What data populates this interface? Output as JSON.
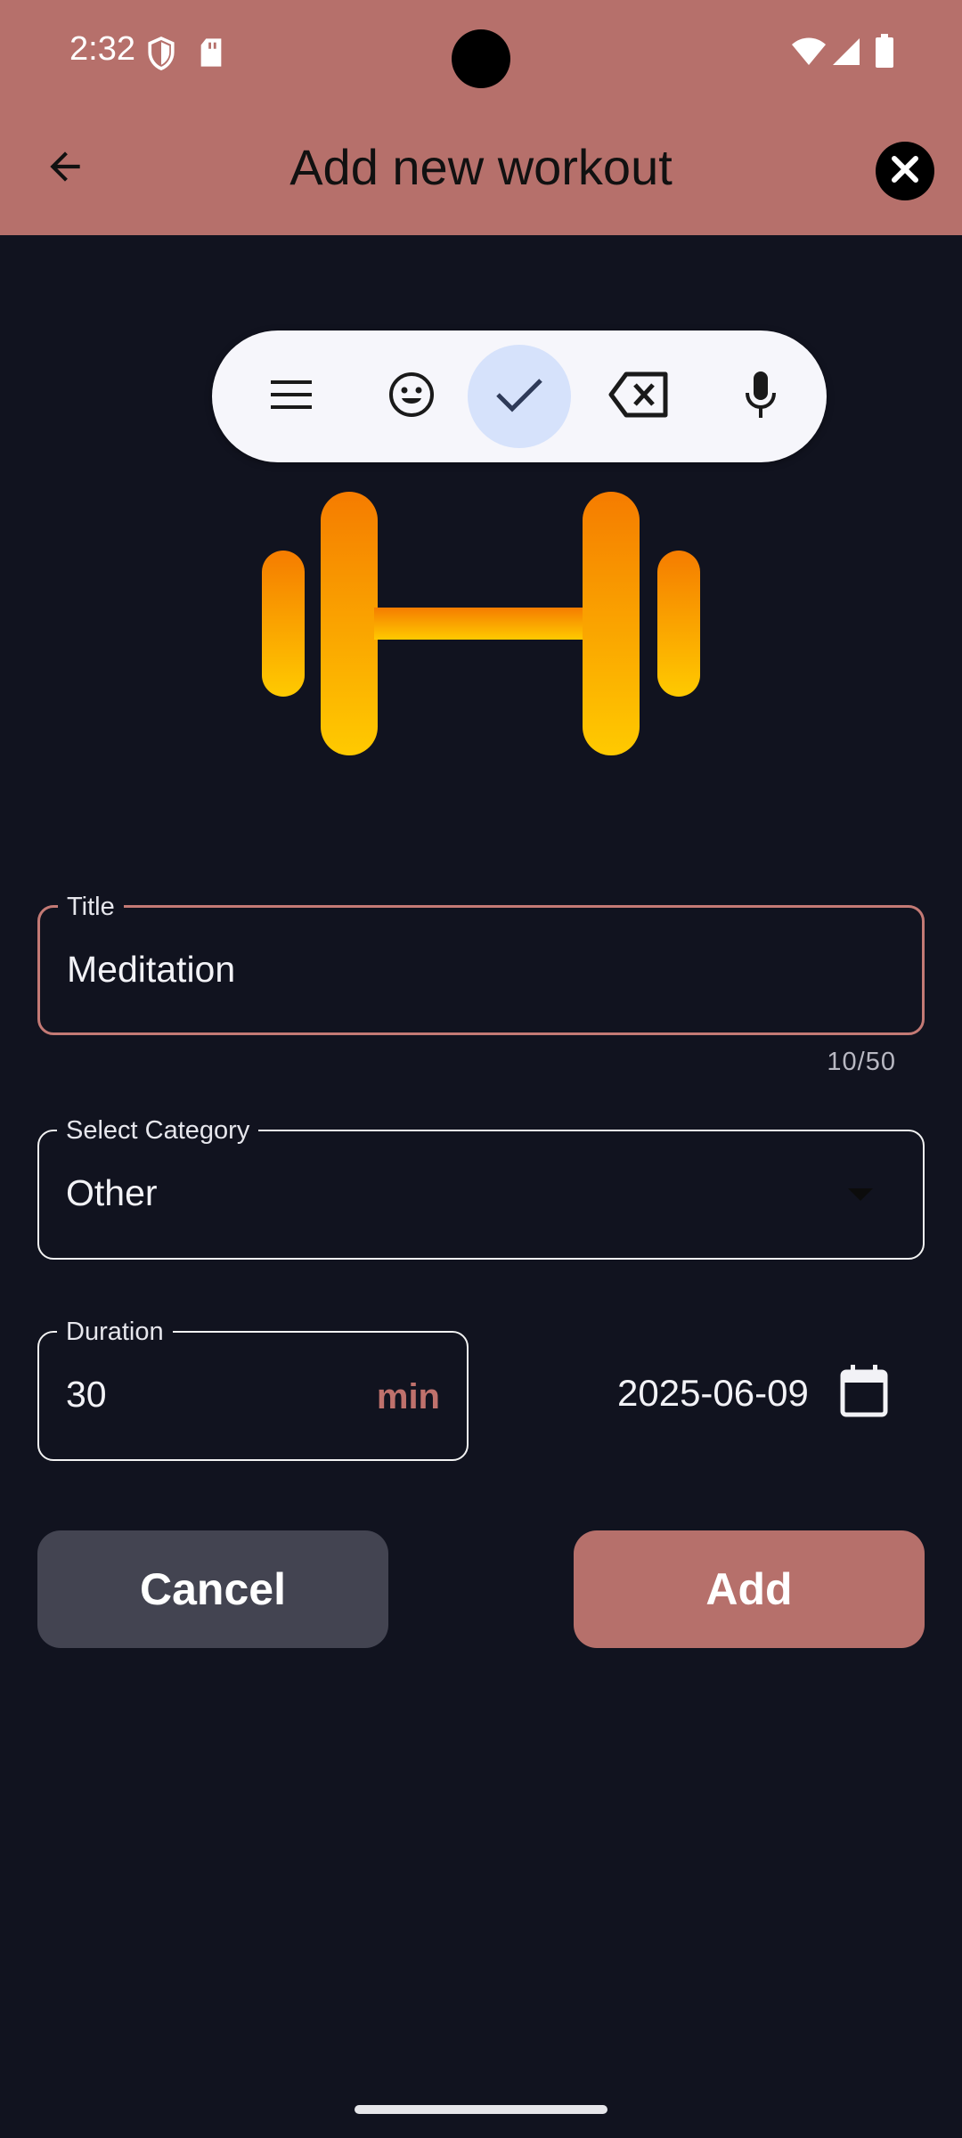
{
  "status_bar": {
    "time": "2:32",
    "icons": [
      "shield-icon",
      "sd-card-icon",
      "wifi-icon",
      "cell-signal-icon",
      "battery-icon"
    ]
  },
  "app_bar": {
    "title": "Add new workout",
    "back_icon": "arrow-back-icon",
    "close_icon": "close-icon"
  },
  "keyboard_toolbar": {
    "items": [
      "menu-icon",
      "emoji-icon",
      "check-icon",
      "backspace-icon",
      "mic-icon"
    ],
    "active_item": "check-icon"
  },
  "hero": {
    "icon": "dumbbell-icon"
  },
  "form": {
    "title_field": {
      "label": "Title",
      "value": "Meditation",
      "counter": "10/50"
    },
    "category_field": {
      "label": "Select Category",
      "value": "Other"
    },
    "duration_field": {
      "label": "Duration",
      "value": "30",
      "suffix": "min"
    },
    "date": "2025-06-09"
  },
  "actions": {
    "cancel_label": "Cancel",
    "add_label": "Add"
  },
  "colors": {
    "accent": "#b6706b",
    "background": "#11131f",
    "cancel_button": "#434451",
    "dumbbell_top": "#f57c00",
    "dumbbell_bottom": "#ffca00"
  }
}
